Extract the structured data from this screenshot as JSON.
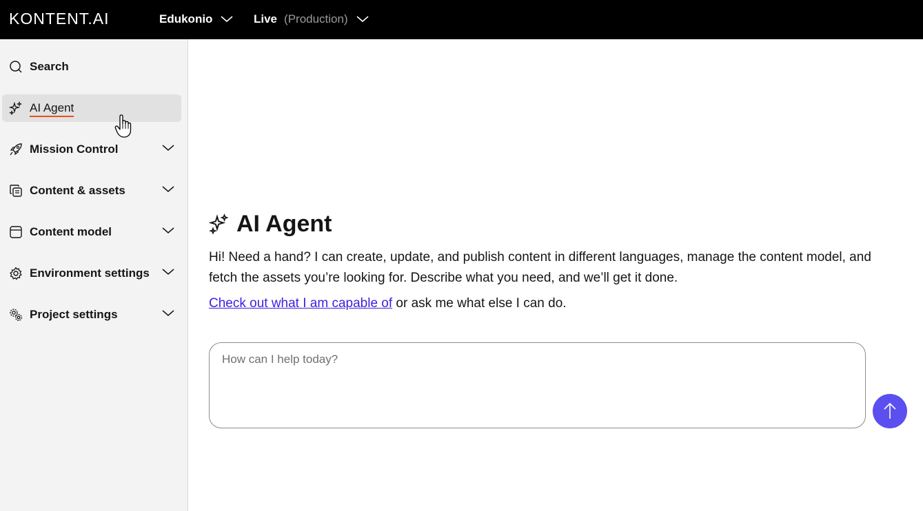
{
  "topbar": {
    "logo": "KONTENT.AI",
    "project": "Edukonio",
    "environment": "Live",
    "environment_type": "(Production)"
  },
  "sidebar": {
    "items": [
      {
        "label": "Search",
        "icon": "search-icon",
        "expandable": false,
        "active": false
      },
      {
        "label": "AI Agent",
        "icon": "sparkles-icon",
        "expandable": false,
        "active": true
      },
      {
        "label": "Mission Control",
        "icon": "rocket-icon",
        "expandable": true,
        "active": false
      },
      {
        "label": "Content & assets",
        "icon": "content-items-icon",
        "expandable": true,
        "active": false
      },
      {
        "label": "Content model",
        "icon": "content-model-icon",
        "expandable": true,
        "active": false
      },
      {
        "label": "Environment settings",
        "icon": "gear-icon",
        "expandable": true,
        "active": false
      },
      {
        "label": "Project settings",
        "icon": "gears-icon",
        "expandable": true,
        "active": false
      }
    ]
  },
  "main": {
    "title": "AI Agent",
    "intro": "Hi! Need a hand? I can create, update, and publish content in different languages, manage the content model, and fetch the assets you’re looking for. Describe what you need, and we’ll get it done.",
    "capable_link": "Check out what I am capable of",
    "capable_rest": " or ask me what else I can do.",
    "prompt_placeholder": "How can I help today?",
    "prompt_value": ""
  },
  "colors": {
    "topbar_bg": "#000000",
    "sidebar_bg": "#f3f3f3",
    "active_item_bg": "#e1e1e1",
    "active_underline": "#e9501c",
    "link": "#3b1fe0",
    "send_button": "#5b4ff0"
  }
}
